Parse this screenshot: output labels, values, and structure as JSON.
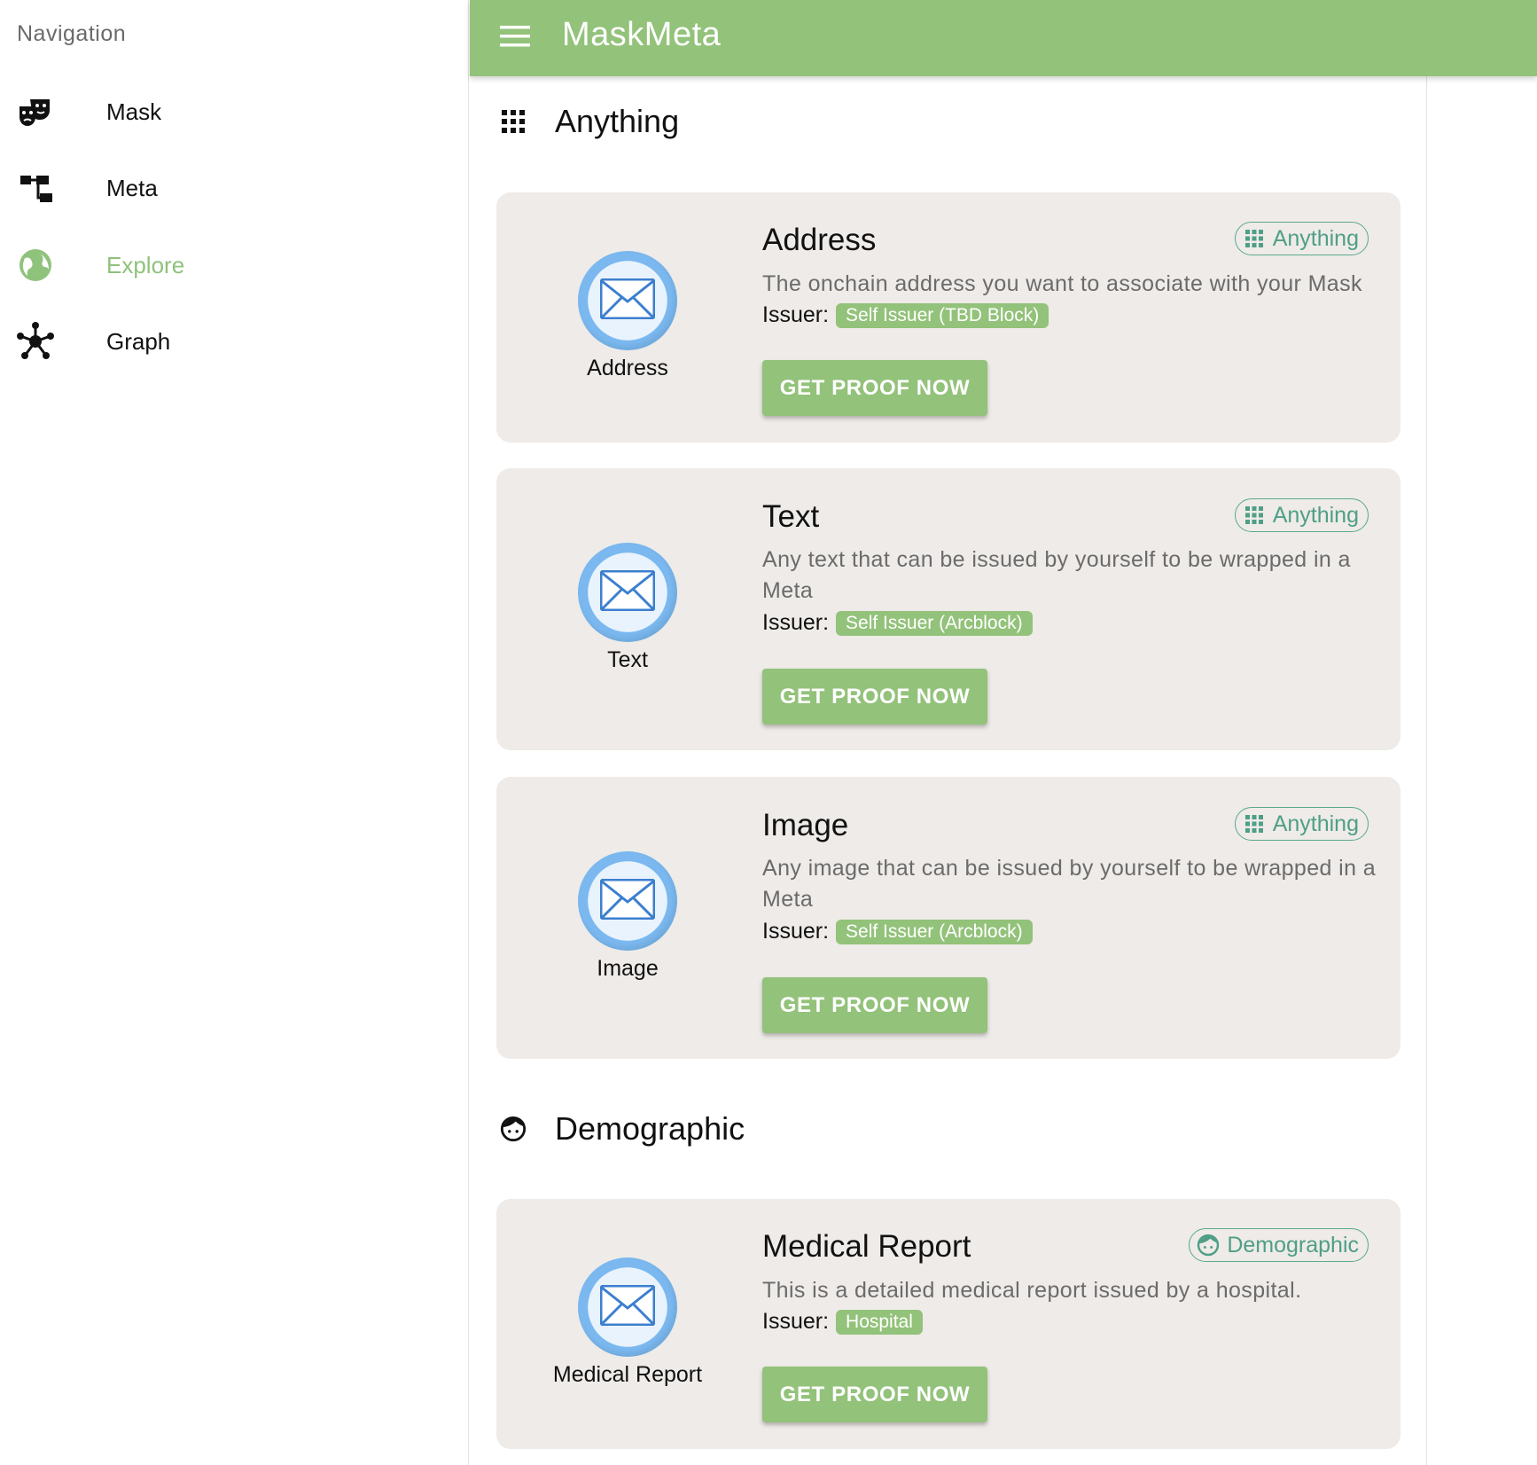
{
  "sidebar": {
    "title": "Navigation",
    "items": [
      {
        "label": "Mask",
        "icon": "theater-masks-icon"
      },
      {
        "label": "Meta",
        "icon": "hierarchy-icon"
      },
      {
        "label": "Explore",
        "icon": "globe-icon",
        "active": true
      },
      {
        "label": "Graph",
        "icon": "graph-nodes-icon"
      }
    ]
  },
  "header": {
    "title": "MaskMeta",
    "menu_icon": "hamburger-menu-icon"
  },
  "colors": {
    "primary": "#93c27a",
    "active_nav": "#8fc27b",
    "tag_outline": "#5aa88e",
    "card_bg": "#eeebe8"
  },
  "sections": [
    {
      "title": "Anything",
      "icon": "apps-grid-icon",
      "cards": [
        {
          "title": "Address",
          "avatar_label": "Address",
          "description": "The onchain address you want to associate with your Mask",
          "issuer_label": "Issuer:",
          "issuer": "Self Issuer (TBD Block)",
          "button": "GET PROOF NOW",
          "tag": "Anything"
        },
        {
          "title": "Text",
          "avatar_label": "Text",
          "description": "Any text that can be issued by yourself to be wrapped in a Meta",
          "issuer_label": "Issuer:",
          "issuer": "Self Issuer (Arcblock)",
          "button": "GET PROOF NOW",
          "tag": "Anything"
        },
        {
          "title": "Image",
          "avatar_label": "Image",
          "description": "Any image that can be issued by yourself to be wrapped in a Meta",
          "issuer_label": "Issuer:",
          "issuer": "Self Issuer (Arcblock)",
          "button": "GET PROOF NOW",
          "tag": "Anything"
        }
      ]
    },
    {
      "title": "Demographic",
      "icon": "face-icon",
      "cards": [
        {
          "title": "Medical Report",
          "avatar_label": "Medical Report",
          "description": "This is a detailed medical report issued by a hospital.",
          "issuer_label": "Issuer:",
          "issuer": "Hospital",
          "button": "GET PROOF NOW",
          "tag": "Demographic"
        }
      ]
    }
  ]
}
